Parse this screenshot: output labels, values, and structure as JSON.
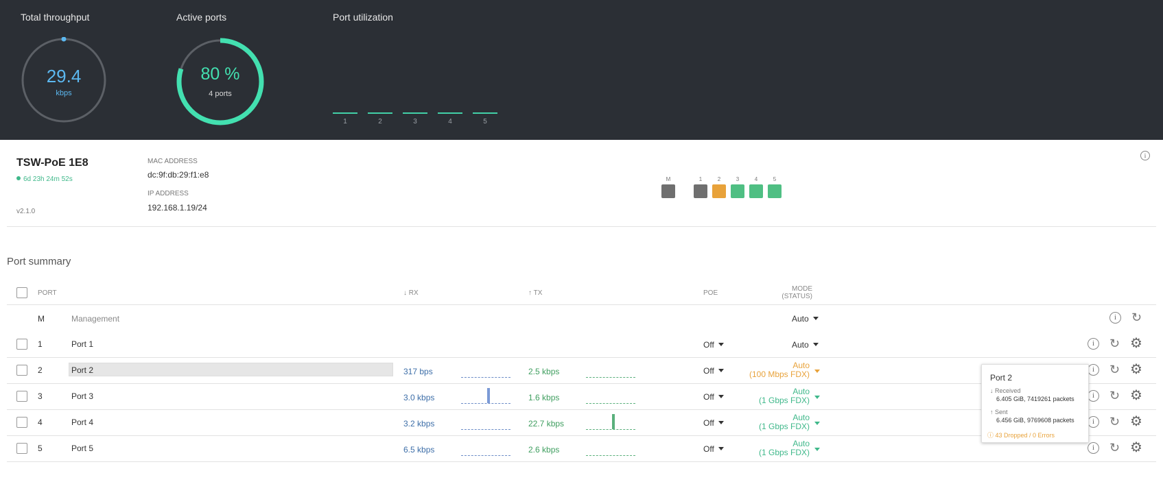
{
  "stats": {
    "throughput": {
      "title": "Total throughput",
      "value": "29.4",
      "unit": "kbps"
    },
    "active_ports": {
      "title": "Active ports",
      "value": "80 %",
      "sub": "4 ports",
      "fraction": 0.8
    },
    "utilization": {
      "title": "Port utilization",
      "ports": [
        "1",
        "2",
        "3",
        "4",
        "5"
      ]
    }
  },
  "device": {
    "name": "TSW-PoE 1E8",
    "uptime": "6d 23h 24m 52s",
    "version": "v2.1.0",
    "mac_label": "MAC ADDRESS",
    "mac": "dc:9f:db:29:f1:e8",
    "ip_label": "IP ADDRESS",
    "ip": "192.168.1.19/24",
    "port_map": [
      {
        "label": "M",
        "color": "#6f6f6f"
      },
      {
        "label": "1",
        "color": "#6f6f6f"
      },
      {
        "label": "2",
        "color": "#e8a23a"
      },
      {
        "label": "3",
        "color": "#4fbf83"
      },
      {
        "label": "4",
        "color": "#4fbf83"
      },
      {
        "label": "5",
        "color": "#4fbf83"
      }
    ]
  },
  "summary": {
    "title": "Port summary",
    "headers": {
      "port": "PORT",
      "rx": "↓ RX",
      "tx": "↑ TX",
      "poe": "POE",
      "mode": "MODE",
      "status": "(STATUS)"
    },
    "management": {
      "port": "M",
      "name": "Management",
      "mode": "Auto"
    },
    "rows": [
      {
        "port": "1",
        "name": "Port 1",
        "rx": "",
        "tx": "",
        "poe": "Off",
        "mode": "Auto",
        "status": "",
        "status_color": "#333333"
      },
      {
        "port": "2",
        "name": "Port 2",
        "rx": "317 bps",
        "tx": "2.5 kbps",
        "poe": "Off",
        "mode": "Auto",
        "status": "(100 Mbps FDX)",
        "status_color": "#e8a23a"
      },
      {
        "port": "3",
        "name": "Port 3",
        "rx": "3.0 kbps",
        "tx": "1.6 kbps",
        "poe": "Off",
        "mode": "Auto",
        "status": "(1 Gbps FDX)",
        "status_color": "#3fb88a"
      },
      {
        "port": "4",
        "name": "Port 4",
        "rx": "3.2 kbps",
        "tx": "22.7 kbps",
        "poe": "Off",
        "mode": "Auto",
        "status": "(1 Gbps FDX)",
        "status_color": "#3fb88a"
      },
      {
        "port": "5",
        "name": "Port 5",
        "rx": "6.5 kbps",
        "tx": "2.6 kbps",
        "poe": "Off",
        "mode": "Auto",
        "status": "(1 Gbps FDX)",
        "status_color": "#3fb88a"
      }
    ]
  },
  "tooltip": {
    "title": "Port 2",
    "received_label": "Received",
    "received": "6.405 GiB, 7419261 packets",
    "sent_label": "Sent",
    "sent": "6.456 GiB, 9769608 packets",
    "warning": "43 Dropped / 0 Errors"
  }
}
